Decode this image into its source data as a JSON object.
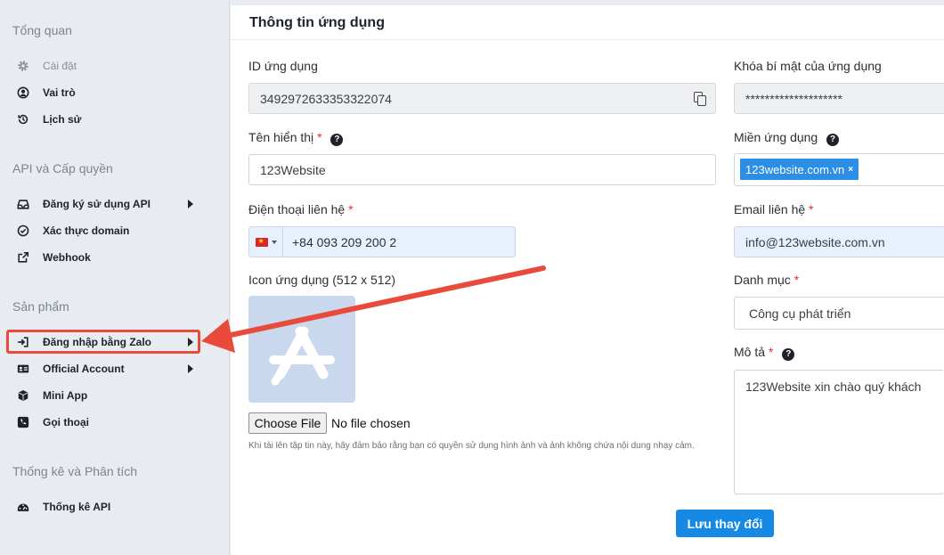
{
  "sidebar": {
    "sections": [
      {
        "title": "Tổng quan"
      },
      {
        "title": "API và Cấp quyền"
      },
      {
        "title": "Sản phẩm"
      },
      {
        "title": "Thống kê và Phân tích"
      }
    ],
    "items": [
      {
        "label": "Cài đặt",
        "icon": "gear-icon"
      },
      {
        "label": "Vai trò",
        "icon": "user-circle-icon"
      },
      {
        "label": "Lịch sử",
        "icon": "history-icon"
      },
      {
        "label": "Đăng ký sử dụng API",
        "icon": "inbox-icon"
      },
      {
        "label": "Xác thực domain",
        "icon": "check-circle-icon"
      },
      {
        "label": "Webhook",
        "icon": "external-link-icon"
      },
      {
        "label": "Đăng nhập bằng Zalo",
        "icon": "sign-in-icon"
      },
      {
        "label": "Official Account",
        "icon": "id-card-icon"
      },
      {
        "label": "Mini App",
        "icon": "cube-icon"
      },
      {
        "label": "Gọi thoại",
        "icon": "phone-icon"
      },
      {
        "label": "Thống kê API",
        "icon": "dashboard-icon"
      }
    ]
  },
  "main": {
    "title": "Thông tin ứng dụng",
    "app_id": {
      "label": "ID ứng dụng",
      "value": "3492972633353322074"
    },
    "secret": {
      "label": "Khóa bí mật của ứng dụng",
      "value": "********************"
    },
    "display_name": {
      "label": "Tên hiển thị",
      "required": "*",
      "value": "123Website"
    },
    "domain": {
      "label": "Miền ứng dụng",
      "tag": "123website.com.vn",
      "tag_remove": "×"
    },
    "phone": {
      "label": "Điện thoại liên hệ",
      "required": "*",
      "value": "+84 093 209 200 2",
      "flag": "vietnam-flag-icon"
    },
    "email": {
      "label": "Email liên hệ",
      "required": "*",
      "value": "info@123website.com.vn"
    },
    "icon": {
      "label": "Icon ứng dụng (512 x 512)",
      "choose_label": "Choose File",
      "file_status": "No file chosen",
      "hint": "Khi tải lên tập tin này, hãy đảm bảo rằng bạn có quyền sử dụng hình ảnh và ảnh không chứa nội dung nhạy cảm."
    },
    "category": {
      "label": "Danh mục",
      "required": "*",
      "value": "Công cụ phát triển"
    },
    "description": {
      "label": "Mô tả",
      "required": "*",
      "value": "123Website xin chào quý khách"
    },
    "save_label": "Lưu thay đổi",
    "help_glyph": "?"
  },
  "colors": {
    "accent": "#1689e5",
    "tag_blue": "#2d8ee6",
    "annotation_red": "#e84b3c",
    "required_red": "#e02d2d",
    "app_icon_bg": "#c9d8ec"
  }
}
